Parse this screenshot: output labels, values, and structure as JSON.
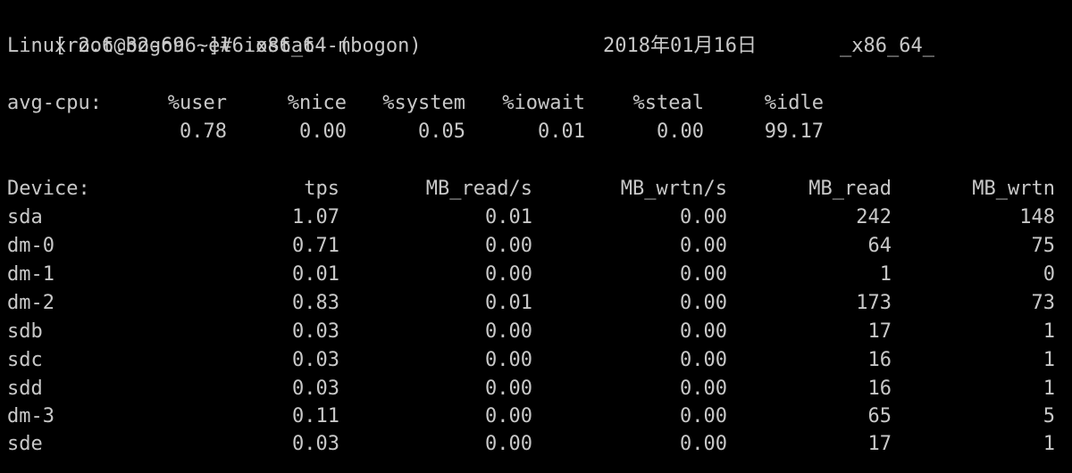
{
  "terminal": {
    "prompt": "[root@bogon ~]# iostat -m",
    "sysinfo": {
      "kernel": "Linux 2.6.32-696.el6.x86_64 (bogon)",
      "date": "2018年01月16日",
      "arch": "_x86_64_"
    },
    "cpu": {
      "label": "avg-cpu:",
      "headers": [
        "%user",
        "%nice",
        "%system",
        "%iowait",
        "%steal",
        "%idle"
      ],
      "values": [
        "0.78",
        "0.00",
        "0.05",
        "0.01",
        "0.00",
        "99.17"
      ]
    },
    "devices": {
      "headers": [
        "Device:",
        "tps",
        "MB_read/s",
        "MB_wrtn/s",
        "MB_read",
        "MB_wrtn"
      ],
      "rows": [
        [
          "sda",
          "1.07",
          "0.01",
          "0.00",
          "242",
          "148"
        ],
        [
          "dm-0",
          "0.71",
          "0.00",
          "0.00",
          "64",
          "75"
        ],
        [
          "dm-1",
          "0.01",
          "0.00",
          "0.00",
          "1",
          "0"
        ],
        [
          "dm-2",
          "0.83",
          "0.01",
          "0.00",
          "173",
          "73"
        ],
        [
          "sdb",
          "0.03",
          "0.00",
          "0.00",
          "17",
          "1"
        ],
        [
          "sdc",
          "0.03",
          "0.00",
          "0.00",
          "16",
          "1"
        ],
        [
          "sdd",
          "0.03",
          "0.00",
          "0.00",
          "16",
          "1"
        ],
        [
          "dm-3",
          "0.11",
          "0.00",
          "0.00",
          "65",
          "5"
        ],
        [
          "sde",
          "0.03",
          "0.00",
          "0.00",
          "17",
          "1"
        ]
      ]
    }
  }
}
